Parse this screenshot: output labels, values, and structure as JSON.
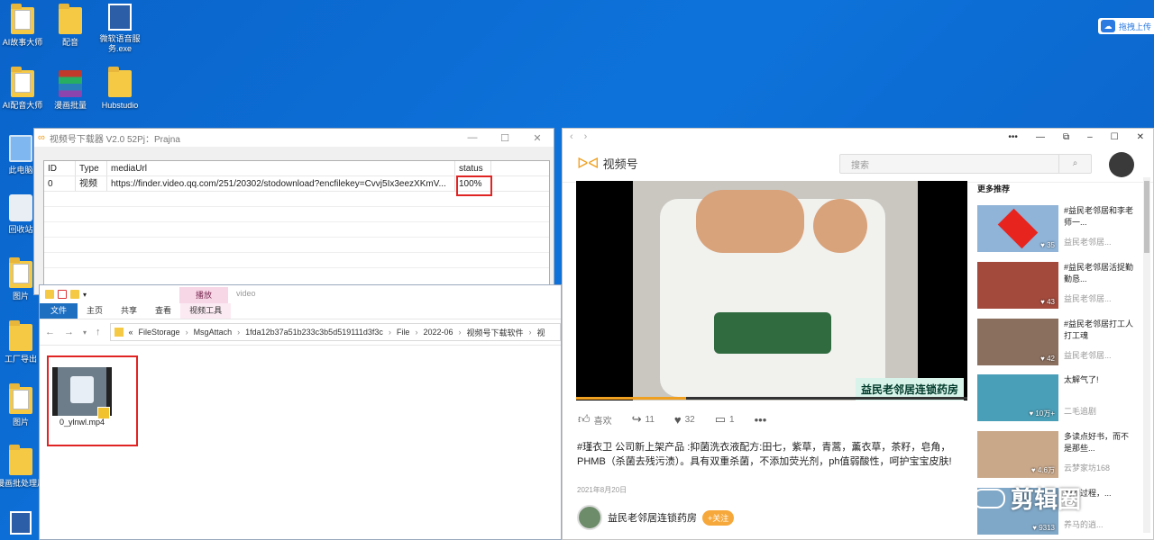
{
  "desktop": {
    "icons": [
      {
        "label": "AI故事大师"
      },
      {
        "label": "配音"
      },
      {
        "label": "微软语音服务.exe"
      },
      {
        "label": "AI配音大师"
      },
      {
        "label": "漫画批量"
      },
      {
        "label": "Hubstudio"
      },
      {
        "label": "此电脑"
      },
      {
        "label": "回收站"
      },
      {
        "label": "图片"
      },
      {
        "label": "工厂导出"
      },
      {
        "label": "图片"
      },
      {
        "label": "漫画批处理片"
      }
    ],
    "cloud_button": "拖拽上传"
  },
  "downloader": {
    "title": "视频号下载器 V2.0 52Pj：Prajna",
    "columns": [
      "ID",
      "Type",
      "mediaUrl",
      "status"
    ],
    "rows": [
      {
        "id": "0",
        "type": "视频",
        "url": "https://finder.video.qq.com/251/20302/stodownload?encfilekey=Cvvj5Ix3eezXKmV...",
        "status": "100%"
      }
    ]
  },
  "explorer": {
    "context_tab": "播放",
    "title": "video",
    "tabs": [
      "文件",
      "主页",
      "共享",
      "查看",
      "视频工具"
    ],
    "breadcrumb": [
      "«",
      "FileStorage",
      "MsgAttach",
      "1fda12b37a51b233c3b5d519111d3f3c",
      "File",
      "2022-06",
      "视频号下载软件",
      "视"
    ],
    "file": {
      "name": "0_ylnwl.mp4"
    }
  },
  "video_browser": {
    "brand": "视频号",
    "search_placeholder": "搜索",
    "video": {
      "caption": "益民老邻居连锁药房",
      "progress": 0.28
    },
    "actions": {
      "like_label": "喜欢",
      "share_count": "11",
      "heart_count": "32",
      "comment_count": "1"
    },
    "description": "#瑾衣卫  公司新上架产品 :抑菌洗衣液配方:田七，紫草，青蒿，薰衣草，茶籽，皂角，PHMB（杀菌去残污渍）。具有双重杀菌，不添加荧光剂，ph值弱酸性，呵护宝宝皮肤!",
    "date": "2021年8月20日",
    "author": "益民老邻居连锁药房",
    "follow_label": "+关注",
    "more_title": "更多推荐",
    "recommendations": [
      {
        "title": "#益民老邻居和李老师一...",
        "author": "益民老邻居...",
        "count": "35"
      },
      {
        "title": "#益民老邻居活捉勤勤恳...",
        "author": "益民老邻居...",
        "count": "43"
      },
      {
        "title": "#益民老邻居打工人 打工魂",
        "author": "益民老邻居...",
        "count": "42"
      },
      {
        "title": "太解气了!",
        "author": "二毛追剧",
        "count": "10万+"
      },
      {
        "title": "多读点好书，而不是那些...",
        "author": "云梦家坊168",
        "count": "4.6万"
      },
      {
        "title": "制作过程，...",
        "author": "养马的逍...",
        "count": "9313"
      }
    ],
    "watermark": "剪辑圈"
  },
  "colors": {
    "desktop_blue": "#0a63c9",
    "highlight_red": "#e02424",
    "brand_orange": "#f0a020",
    "follow_orange": "#f7a83a"
  }
}
